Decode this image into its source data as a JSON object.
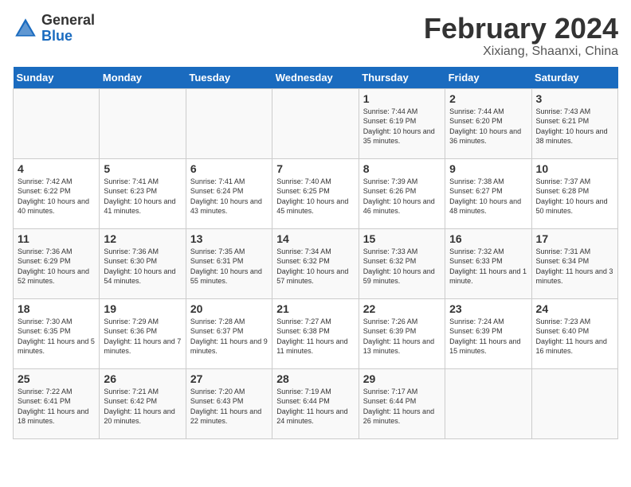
{
  "header": {
    "logo_general": "General",
    "logo_blue": "Blue",
    "month_title": "February 2024",
    "location": "Xixiang, Shaanxi, China"
  },
  "days_of_week": [
    "Sunday",
    "Monday",
    "Tuesday",
    "Wednesday",
    "Thursday",
    "Friday",
    "Saturday"
  ],
  "weeks": [
    [
      {
        "day": "",
        "info": ""
      },
      {
        "day": "",
        "info": ""
      },
      {
        "day": "",
        "info": ""
      },
      {
        "day": "",
        "info": ""
      },
      {
        "day": "1",
        "info": "Sunrise: 7:44 AM\nSunset: 6:19 PM\nDaylight: 10 hours\nand 35 minutes."
      },
      {
        "day": "2",
        "info": "Sunrise: 7:44 AM\nSunset: 6:20 PM\nDaylight: 10 hours\nand 36 minutes."
      },
      {
        "day": "3",
        "info": "Sunrise: 7:43 AM\nSunset: 6:21 PM\nDaylight: 10 hours\nand 38 minutes."
      }
    ],
    [
      {
        "day": "4",
        "info": "Sunrise: 7:42 AM\nSunset: 6:22 PM\nDaylight: 10 hours\nand 40 minutes."
      },
      {
        "day": "5",
        "info": "Sunrise: 7:41 AM\nSunset: 6:23 PM\nDaylight: 10 hours\nand 41 minutes."
      },
      {
        "day": "6",
        "info": "Sunrise: 7:41 AM\nSunset: 6:24 PM\nDaylight: 10 hours\nand 43 minutes."
      },
      {
        "day": "7",
        "info": "Sunrise: 7:40 AM\nSunset: 6:25 PM\nDaylight: 10 hours\nand 45 minutes."
      },
      {
        "day": "8",
        "info": "Sunrise: 7:39 AM\nSunset: 6:26 PM\nDaylight: 10 hours\nand 46 minutes."
      },
      {
        "day": "9",
        "info": "Sunrise: 7:38 AM\nSunset: 6:27 PM\nDaylight: 10 hours\nand 48 minutes."
      },
      {
        "day": "10",
        "info": "Sunrise: 7:37 AM\nSunset: 6:28 PM\nDaylight: 10 hours\nand 50 minutes."
      }
    ],
    [
      {
        "day": "11",
        "info": "Sunrise: 7:36 AM\nSunset: 6:29 PM\nDaylight: 10 hours\nand 52 minutes."
      },
      {
        "day": "12",
        "info": "Sunrise: 7:36 AM\nSunset: 6:30 PM\nDaylight: 10 hours\nand 54 minutes."
      },
      {
        "day": "13",
        "info": "Sunrise: 7:35 AM\nSunset: 6:31 PM\nDaylight: 10 hours\nand 55 minutes."
      },
      {
        "day": "14",
        "info": "Sunrise: 7:34 AM\nSunset: 6:32 PM\nDaylight: 10 hours\nand 57 minutes."
      },
      {
        "day": "15",
        "info": "Sunrise: 7:33 AM\nSunset: 6:32 PM\nDaylight: 10 hours\nand 59 minutes."
      },
      {
        "day": "16",
        "info": "Sunrise: 7:32 AM\nSunset: 6:33 PM\nDaylight: 11 hours\nand 1 minute."
      },
      {
        "day": "17",
        "info": "Sunrise: 7:31 AM\nSunset: 6:34 PM\nDaylight: 11 hours\nand 3 minutes."
      }
    ],
    [
      {
        "day": "18",
        "info": "Sunrise: 7:30 AM\nSunset: 6:35 PM\nDaylight: 11 hours\nand 5 minutes."
      },
      {
        "day": "19",
        "info": "Sunrise: 7:29 AM\nSunset: 6:36 PM\nDaylight: 11 hours\nand 7 minutes."
      },
      {
        "day": "20",
        "info": "Sunrise: 7:28 AM\nSunset: 6:37 PM\nDaylight: 11 hours\nand 9 minutes."
      },
      {
        "day": "21",
        "info": "Sunrise: 7:27 AM\nSunset: 6:38 PM\nDaylight: 11 hours\nand 11 minutes."
      },
      {
        "day": "22",
        "info": "Sunrise: 7:26 AM\nSunset: 6:39 PM\nDaylight: 11 hours\nand 13 minutes."
      },
      {
        "day": "23",
        "info": "Sunrise: 7:24 AM\nSunset: 6:39 PM\nDaylight: 11 hours\nand 15 minutes."
      },
      {
        "day": "24",
        "info": "Sunrise: 7:23 AM\nSunset: 6:40 PM\nDaylight: 11 hours\nand 16 minutes."
      }
    ],
    [
      {
        "day": "25",
        "info": "Sunrise: 7:22 AM\nSunset: 6:41 PM\nDaylight: 11 hours\nand 18 minutes."
      },
      {
        "day": "26",
        "info": "Sunrise: 7:21 AM\nSunset: 6:42 PM\nDaylight: 11 hours\nand 20 minutes."
      },
      {
        "day": "27",
        "info": "Sunrise: 7:20 AM\nSunset: 6:43 PM\nDaylight: 11 hours\nand 22 minutes."
      },
      {
        "day": "28",
        "info": "Sunrise: 7:19 AM\nSunset: 6:44 PM\nDaylight: 11 hours\nand 24 minutes."
      },
      {
        "day": "29",
        "info": "Sunrise: 7:17 AM\nSunset: 6:44 PM\nDaylight: 11 hours\nand 26 minutes."
      },
      {
        "day": "",
        "info": ""
      },
      {
        "day": "",
        "info": ""
      }
    ]
  ]
}
